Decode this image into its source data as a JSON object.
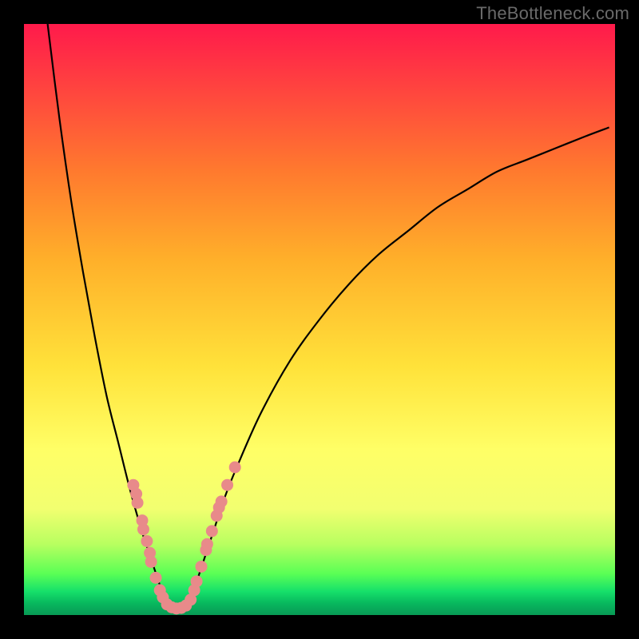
{
  "watermark": "TheBottleneck.com",
  "colors": {
    "background_frame": "#000000",
    "curve_stroke": "#000000",
    "dot_fill": "#e88a8a",
    "gradient_top": "#ff1a4b",
    "gradient_bottom": "#089a55"
  },
  "chart_data": {
    "type": "line",
    "title": "",
    "xlabel": "",
    "ylabel": "",
    "xlim": [
      0,
      100
    ],
    "ylim": [
      0,
      100
    ],
    "grid": false,
    "legend": false,
    "series": [
      {
        "name": "left-branch",
        "x": [
          4,
          6,
          8,
          10,
          12,
          14,
          16,
          18,
          20,
          21,
          22,
          23,
          24
        ],
        "y": [
          100,
          84,
          70,
          58,
          47,
          37,
          29,
          21,
          14,
          11,
          8,
          5,
          2
        ]
      },
      {
        "name": "right-branch",
        "x": [
          28,
          29,
          30,
          32,
          34,
          36,
          40,
          45,
          50,
          55,
          60,
          65,
          70,
          75,
          80,
          85,
          90,
          95,
          99
        ],
        "y": [
          2,
          5,
          8,
          14,
          20,
          25,
          34,
          43,
          50,
          56,
          61,
          65,
          69,
          72,
          75,
          77,
          79,
          81,
          82.5
        ]
      },
      {
        "name": "valley-floor",
        "x": [
          24,
          25,
          26,
          27,
          28
        ],
        "y": [
          2,
          1.2,
          1,
          1.2,
          2
        ]
      }
    ],
    "markers": {
      "name": "highlight-dots",
      "points": [
        {
          "x": 18.5,
          "y": 22
        },
        {
          "x": 19.0,
          "y": 20.5
        },
        {
          "x": 19.2,
          "y": 19
        },
        {
          "x": 20.0,
          "y": 16
        },
        {
          "x": 20.2,
          "y": 14.5
        },
        {
          "x": 20.8,
          "y": 12.5
        },
        {
          "x": 21.3,
          "y": 10.5
        },
        {
          "x": 21.5,
          "y": 9
        },
        {
          "x": 22.3,
          "y": 6.3
        },
        {
          "x": 23.0,
          "y": 4.2
        },
        {
          "x": 23.5,
          "y": 3.0
        },
        {
          "x": 24.2,
          "y": 1.8
        },
        {
          "x": 25.0,
          "y": 1.3
        },
        {
          "x": 25.8,
          "y": 1.1
        },
        {
          "x": 26.6,
          "y": 1.2
        },
        {
          "x": 27.4,
          "y": 1.6
        },
        {
          "x": 28.2,
          "y": 2.6
        },
        {
          "x": 28.8,
          "y": 4.2
        },
        {
          "x": 29.2,
          "y": 5.7
        },
        {
          "x": 30.0,
          "y": 8.2
        },
        {
          "x": 30.8,
          "y": 11.0
        },
        {
          "x": 31.0,
          "y": 12.0
        },
        {
          "x": 31.8,
          "y": 14.2
        },
        {
          "x": 32.6,
          "y": 16.8
        },
        {
          "x": 33.0,
          "y": 18.2
        },
        {
          "x": 33.4,
          "y": 19.2
        },
        {
          "x": 34.4,
          "y": 22.0
        },
        {
          "x": 35.7,
          "y": 25.0
        }
      ]
    }
  }
}
